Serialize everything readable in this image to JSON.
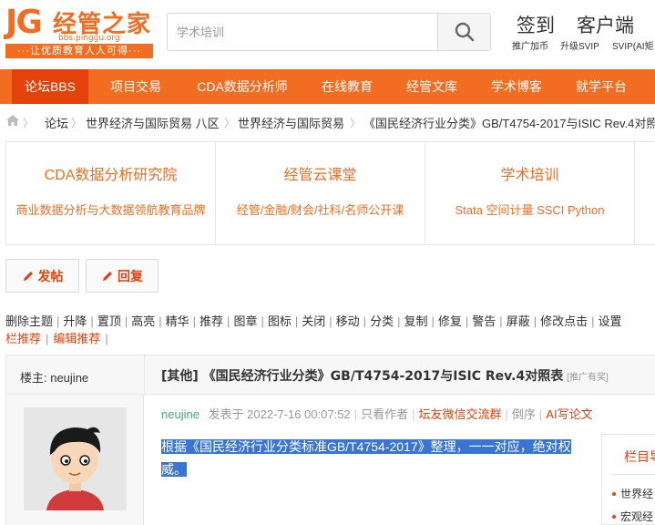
{
  "brand": {
    "logo_letters": "JG",
    "logo_name": "经管之家",
    "logo_url": "bbs.pinggu.org",
    "slogan": "···让优质教育人人可得···",
    "accent": "#f26d21",
    "accent_dark": "#e4410b"
  },
  "search": {
    "placeholder": "学术培训"
  },
  "header_links": {
    "signin": "签到",
    "client": "客户端",
    "promote": "推广加币",
    "upgrade": "升级SVIP",
    "svip_ai": "SVIP(AI矩"
  },
  "nav": {
    "items": [
      {
        "label": "论坛BBS",
        "active": true
      },
      {
        "label": "项目交易"
      },
      {
        "label": "CDA数据分析师"
      },
      {
        "label": "在线教育"
      },
      {
        "label": "经管文库"
      },
      {
        "label": "学术博客"
      },
      {
        "label": "就学平台"
      }
    ]
  },
  "breadcrumb": {
    "home_icon": "home-icon",
    "items": [
      "论坛",
      "世界经济与国际贸易 八区",
      "世界经济与国际贸易",
      "《国民经济行业分类》GB/T4754-2017与ISIC Rev.4对照"
    ]
  },
  "promos": [
    {
      "title": "CDA数据分析研究院",
      "subtitle": "商业数据分析与大数据领航教育品牌"
    },
    {
      "title": "经管云课堂",
      "subtitle": "经管/金融/财会/社科/名师公开课"
    },
    {
      "title": "学术培训",
      "subtitle": "Stata 空间计量 SSCI Python"
    }
  ],
  "actions": {
    "post": "发帖",
    "reply": "回复",
    "icon": "pencil-icon"
  },
  "mod_tools": [
    "删除主题",
    "升降",
    "置顶",
    "高亮",
    "精华",
    "推荐",
    "图章",
    "图标",
    "关闭",
    "移动",
    "分类",
    "复制",
    "修复",
    "警告",
    "屏蔽",
    "修改点击",
    "设置"
  ],
  "mod_tools2": [
    "栏推荐",
    "编辑推荐"
  ],
  "thread": {
    "op_label": "楼主: neujine",
    "category": "[其他]",
    "title": "《国民经济行业分类》GB/T4754-2017与ISIC Rev.4对照表",
    "tag": "[推广有奖]"
  },
  "post": {
    "author": "neujine",
    "posted": "发表于 2022-7-16 00:07:52",
    "only_author": "只看作者",
    "wechat": "坛友微信交流群",
    "reverse": "倒序",
    "ai_write": "AI写论文",
    "body_line1": "根据《国民经济行业分类标准GB/T4754-2017》整理，一一对应，绝对权",
    "body_line2": "威。"
  },
  "sidebar": {
    "title": "栏目导",
    "items": [
      "世界经",
      "宏观经"
    ]
  }
}
